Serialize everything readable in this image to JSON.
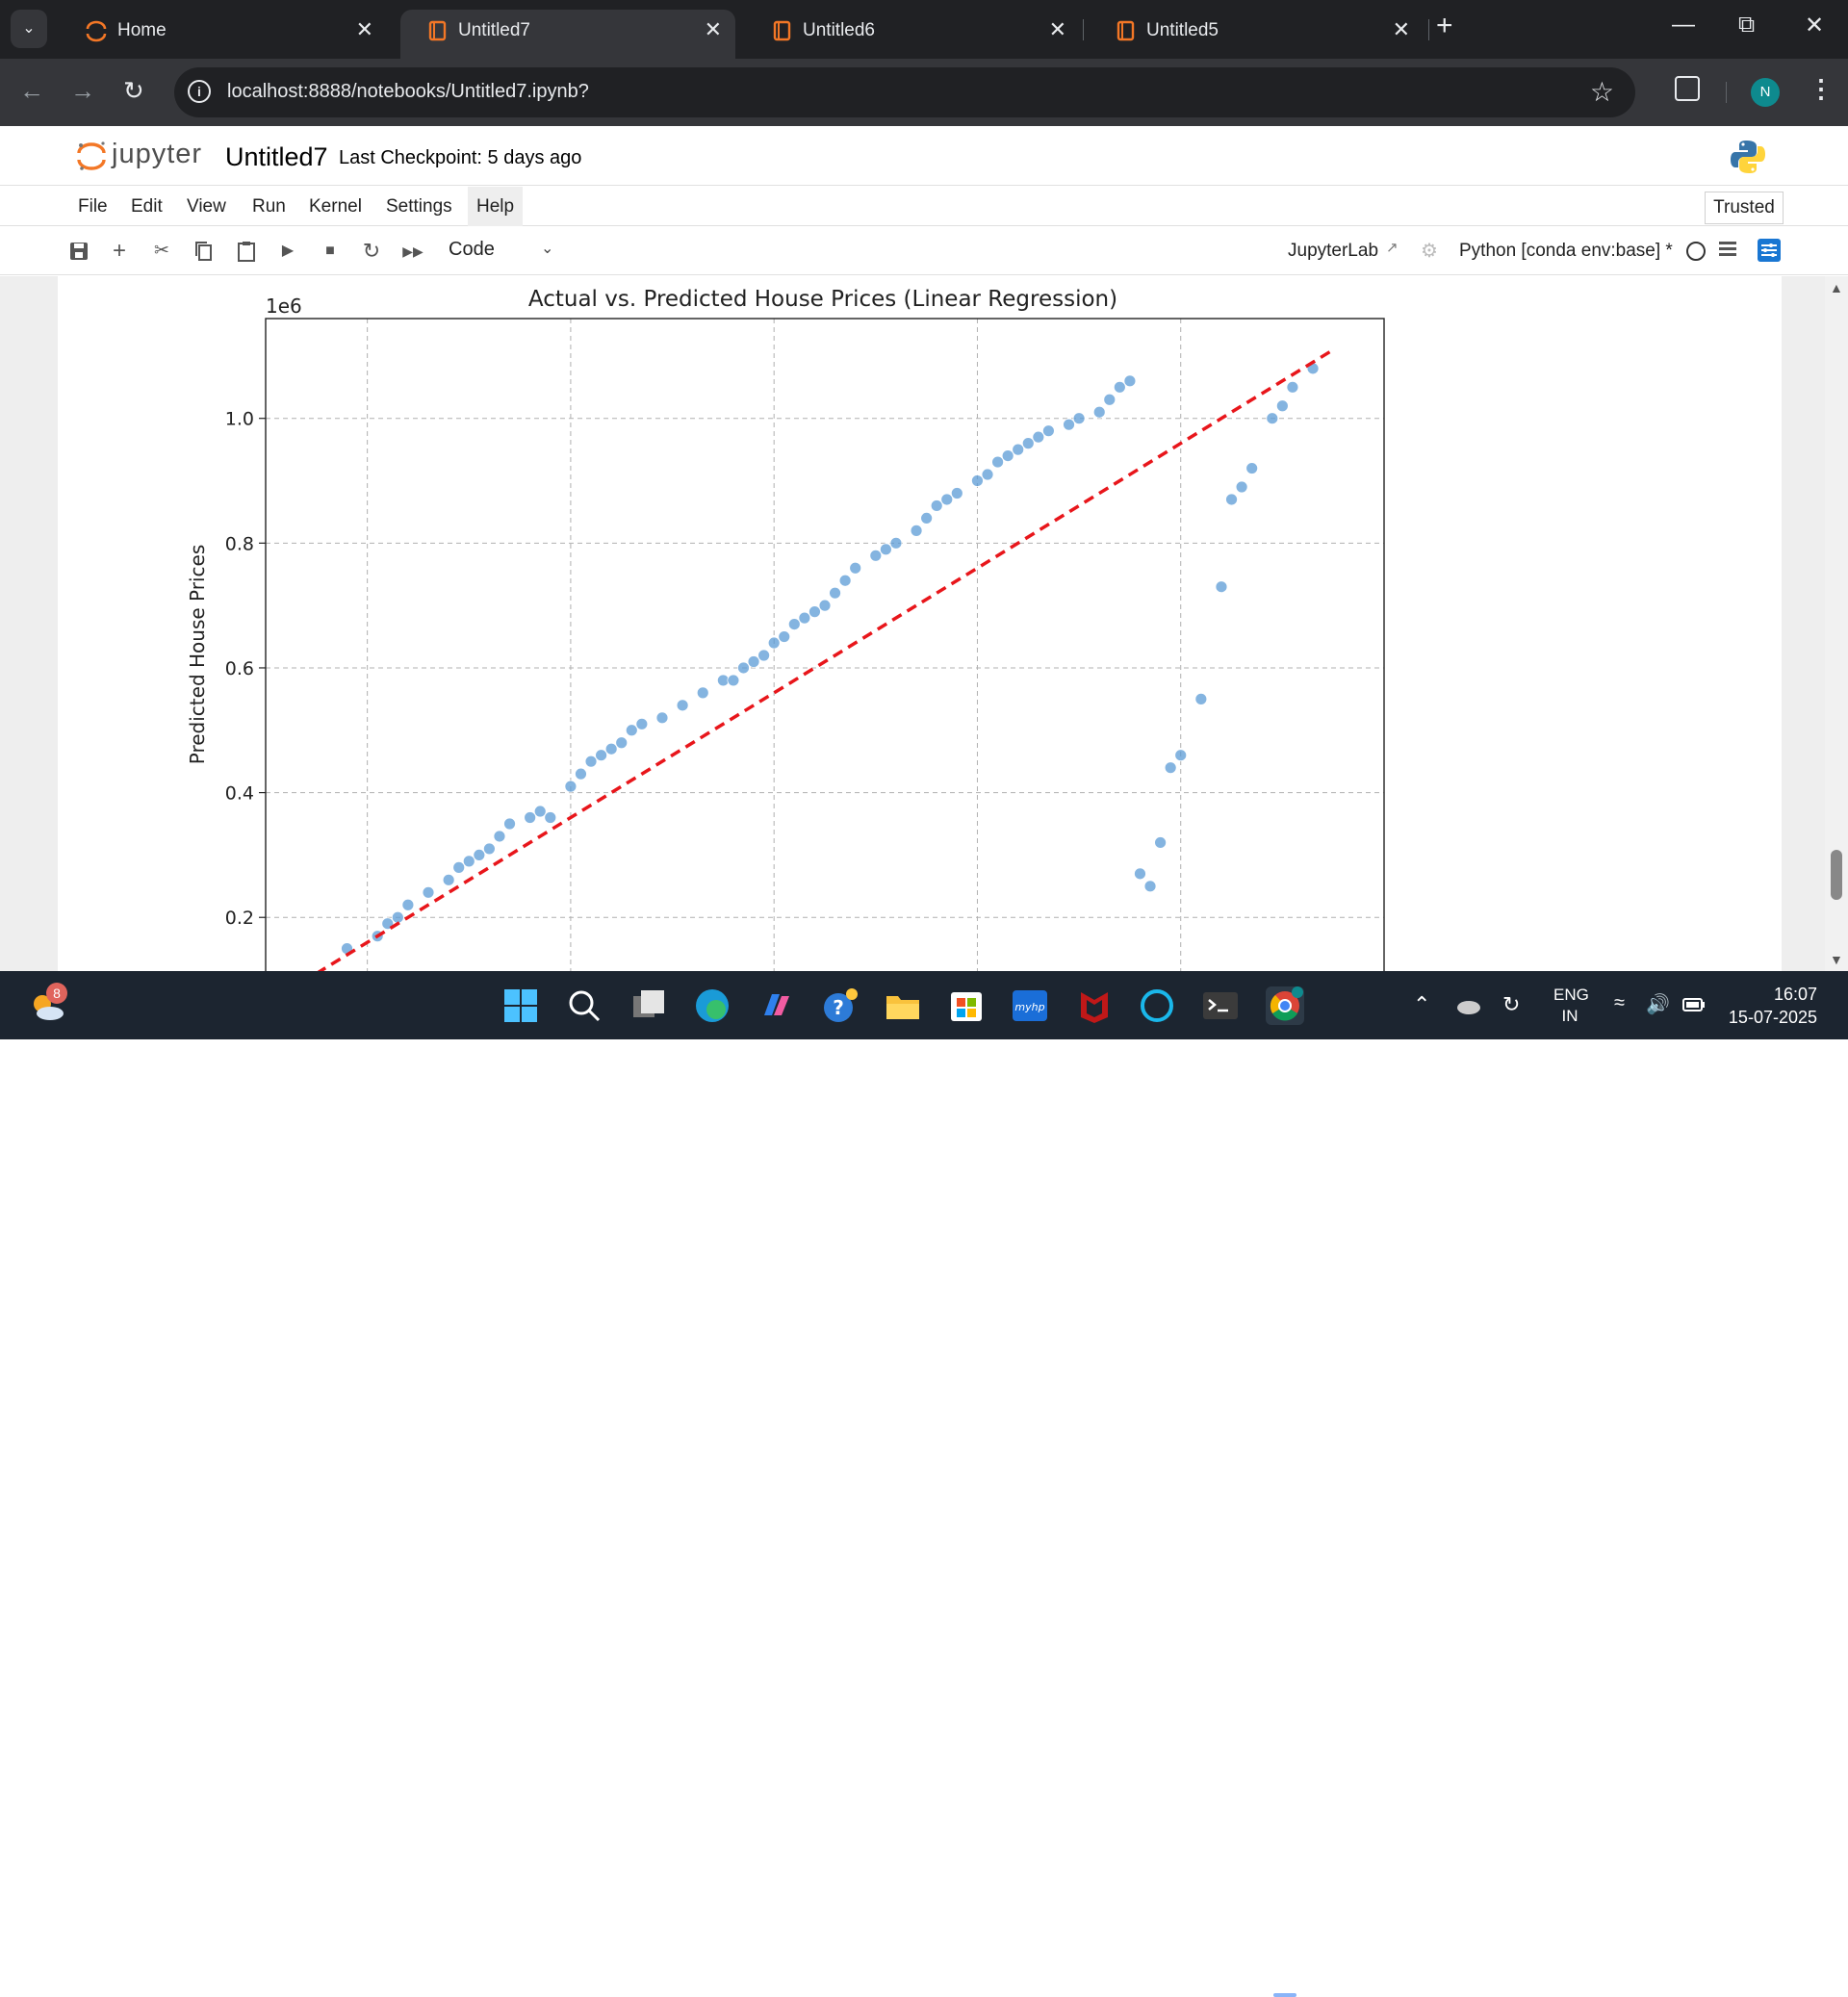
{
  "browser": {
    "tabs": [
      {
        "label": "Home",
        "active": false
      },
      {
        "label": "Untitled7",
        "active": true
      },
      {
        "label": "Untitled6",
        "active": false
      },
      {
        "label": "Untitled5",
        "active": false
      }
    ],
    "url": "localhost:8888/notebooks/Untitled7.ipynb?",
    "profile_initial": "N"
  },
  "jupyter": {
    "logo_text": "jupyter",
    "notebook_title": "Untitled7",
    "checkpoint": "Last Checkpoint: 5 days ago",
    "menu": [
      "File",
      "Edit",
      "View",
      "Run",
      "Kernel",
      "Settings",
      "Help"
    ],
    "trusted_label": "Trusted",
    "cell_type": "Code",
    "jupyterlab_link": "JupyterLab",
    "kernel_name": "Python [conda env:base] *"
  },
  "chart_data": {
    "type": "scatter",
    "title": "Actual vs. Predicted House Prices (Linear Regression)",
    "ylabel": "Predicted House Prices",
    "offset_label": "1e6",
    "yticks": [
      0.2,
      0.4,
      0.6,
      0.8,
      1.0
    ],
    "ylim": [
      0.08,
      1.16
    ],
    "xlim": [
      0.0,
      1.1
    ],
    "grid": true,
    "point_color": "#5b9bd5",
    "fit_line_color": "#e8161b",
    "fit_line": [
      [
        0.05,
        0.11
      ],
      [
        1.05,
        1.11
      ]
    ],
    "x": [
      0.08,
      0.11,
      0.12,
      0.13,
      0.14,
      0.16,
      0.18,
      0.19,
      0.2,
      0.21,
      0.22,
      0.23,
      0.24,
      0.26,
      0.27,
      0.28,
      0.3,
      0.31,
      0.32,
      0.33,
      0.34,
      0.35,
      0.36,
      0.37,
      0.39,
      0.41,
      0.43,
      0.45,
      0.46,
      0.47,
      0.48,
      0.49,
      0.5,
      0.51,
      0.52,
      0.53,
      0.54,
      0.55,
      0.56,
      0.57,
      0.58,
      0.6,
      0.61,
      0.62,
      0.64,
      0.65,
      0.66,
      0.67,
      0.68,
      0.7,
      0.71,
      0.72,
      0.73,
      0.74,
      0.75,
      0.76,
      0.77,
      0.79,
      0.8,
      0.82,
      0.83,
      0.84,
      0.85,
      0.86,
      0.87,
      0.88,
      0.89,
      0.9,
      0.92,
      0.94,
      0.95,
      0.96,
      0.97,
      0.99,
      1.0,
      1.01,
      1.03
    ],
    "y": [
      0.15,
      0.17,
      0.19,
      0.2,
      0.22,
      0.24,
      0.26,
      0.28,
      0.29,
      0.3,
      0.31,
      0.33,
      0.35,
      0.36,
      0.37,
      0.36,
      0.41,
      0.43,
      0.45,
      0.46,
      0.47,
      0.48,
      0.5,
      0.51,
      0.52,
      0.54,
      0.56,
      0.58,
      0.58,
      0.6,
      0.61,
      0.62,
      0.64,
      0.65,
      0.67,
      0.68,
      0.69,
      0.7,
      0.72,
      0.74,
      0.76,
      0.78,
      0.79,
      0.8,
      0.82,
      0.84,
      0.86,
      0.87,
      0.88,
      0.9,
      0.91,
      0.93,
      0.94,
      0.95,
      0.96,
      0.97,
      0.98,
      0.99,
      1.0,
      1.01,
      1.03,
      1.05,
      1.06,
      0.27,
      0.25,
      0.32,
      0.44,
      0.46,
      0.55,
      0.73,
      0.87,
      0.89,
      0.92,
      1.0,
      1.02,
      1.05,
      1.08
    ]
  },
  "taskbar": {
    "weather_badge": "8",
    "lang_top": "ENG",
    "lang_bottom": "IN",
    "time": "16:07",
    "date": "15-07-2025"
  }
}
